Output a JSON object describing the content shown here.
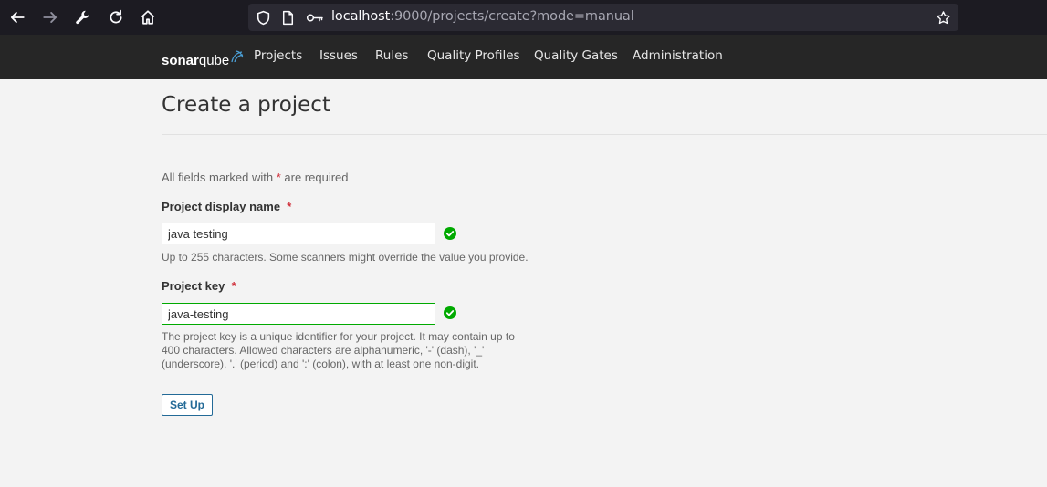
{
  "browser": {
    "url_host": "localhost",
    "url_rest": ":9000/projects/create?mode=manual"
  },
  "nav": {
    "logo_bold": "sonar",
    "logo_light": "qube",
    "items": [
      "Projects",
      "Issues",
      "Rules",
      "Quality Profiles",
      "Quality Gates",
      "Administration"
    ]
  },
  "page": {
    "title": "Create a project",
    "required_note_prefix": "All fields marked with ",
    "required_note_star": "*",
    "required_note_suffix": " are required"
  },
  "form": {
    "display_name": {
      "label": "Project display name",
      "star": "*",
      "value": "java testing",
      "help": "Up to 255 characters. Some scanners might override the value you provide."
    },
    "project_key": {
      "label": "Project key",
      "star": "*",
      "value": "java-testing",
      "help_line1": "The project key is a unique identifier for your project. It may contain up to",
      "help_line2": "400 characters. Allowed characters are alphanumeric, '-' (dash), '_'",
      "help_line3": "(underscore), '.' (period) and ':' (colon), with at least one non-digit."
    },
    "submit_label": "Set Up"
  },
  "colors": {
    "valid": "#00aa00",
    "required": "#d02f3a",
    "primary": "#236a97"
  }
}
